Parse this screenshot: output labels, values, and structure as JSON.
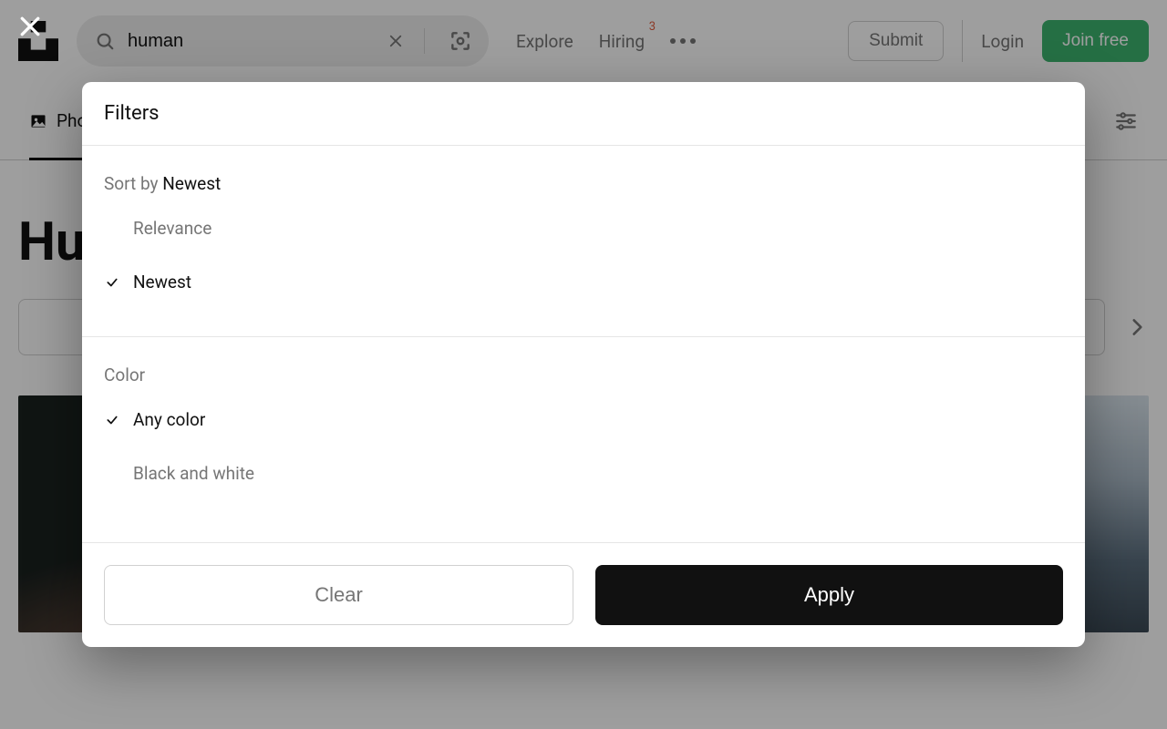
{
  "search": {
    "query": "human"
  },
  "nav": {
    "explore": "Explore",
    "hiring": "Hiring",
    "hiring_badge": "3",
    "submit": "Submit",
    "login": "Login",
    "join": "Join free"
  },
  "tabs": {
    "photos": "Photos"
  },
  "page": {
    "heading": "Human"
  },
  "modal": {
    "title": "Filters",
    "sort_label": "Sort by ",
    "sort_current": "Newest",
    "sort_options": {
      "relevance": "Relevance",
      "newest": "Newest"
    },
    "color_label": "Color",
    "color_options": {
      "any": "Any color",
      "bw": "Black and white"
    },
    "clear": "Clear",
    "apply": "Apply"
  }
}
